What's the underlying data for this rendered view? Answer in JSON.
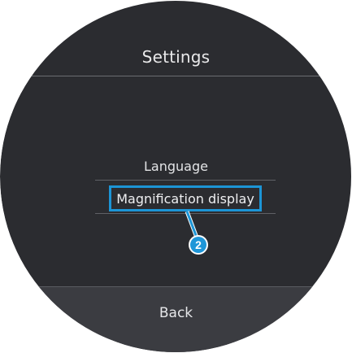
{
  "header": {
    "title": "Settings"
  },
  "menu": {
    "items": [
      {
        "label": "Language"
      },
      {
        "label": "Magnification display",
        "highlighted": true
      }
    ]
  },
  "callout": {
    "number": "2"
  },
  "footer": {
    "back_label": "Back"
  },
  "colors": {
    "background": "#2b2c30",
    "footer": "#3b3c41",
    "highlight": "#1c95d6",
    "text": "#e6e7e9"
  }
}
